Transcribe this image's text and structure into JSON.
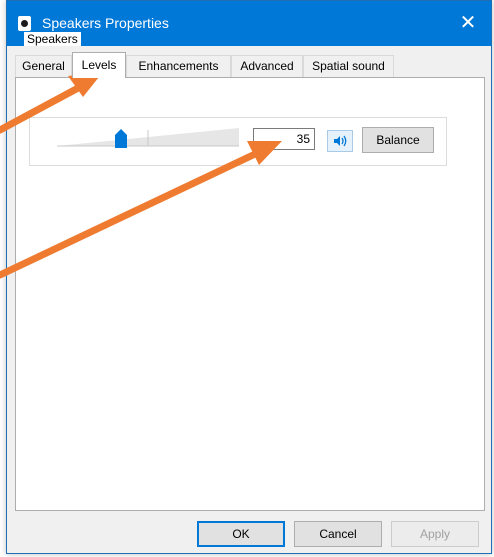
{
  "window": {
    "title": "Speakers Properties",
    "close_glyph": "✕"
  },
  "tabs": [
    {
      "label": "General",
      "active": false
    },
    {
      "label": "Levels",
      "active": true
    },
    {
      "label": "Enhancements",
      "active": false
    },
    {
      "label": "Advanced",
      "active": false
    },
    {
      "label": "Spatial sound",
      "active": false
    }
  ],
  "levels": {
    "group_label": "Speakers",
    "volume_value": "35",
    "volume_fraction": 0.35,
    "mute_icon": "speaker-volume-icon",
    "balance_label": "Balance"
  },
  "footer": {
    "ok_label": "OK",
    "cancel_label": "Cancel",
    "apply_label": "Apply"
  },
  "colors": {
    "titlebar": "#0078d7",
    "accent": "#0078d7",
    "annotation_arrow": "#ef7b30"
  }
}
